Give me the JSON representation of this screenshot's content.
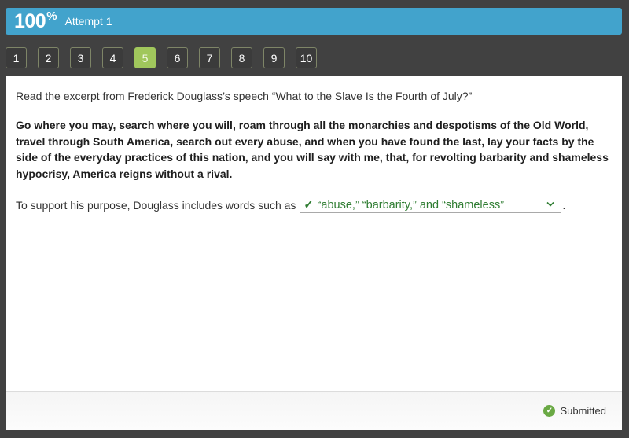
{
  "header": {
    "score": "100",
    "score_suffix": "%",
    "attempt_label": "Attempt 1",
    "accent_color": "#42a3cc"
  },
  "question_nav": {
    "items": [
      {
        "label": "1",
        "active": false
      },
      {
        "label": "2",
        "active": false
      },
      {
        "label": "3",
        "active": false
      },
      {
        "label": "4",
        "active": false
      },
      {
        "label": "5",
        "active": true
      },
      {
        "label": "6",
        "active": false
      },
      {
        "label": "7",
        "active": false
      },
      {
        "label": "8",
        "active": false
      },
      {
        "label": "9",
        "active": false
      },
      {
        "label": "10",
        "active": false
      }
    ],
    "active_color": "#a0c75c"
  },
  "question": {
    "intro": "Read the excerpt from Frederick Douglass’s speech “What to the Slave Is the Fourth of July?”",
    "excerpt": "Go where you may, search where you will, roam through all the monarchies and despotisms of the Old World, travel through South America, search out every abuse, and when you have found the last, lay your facts by the side of the everyday practices of this nation, and you will say with me, that, for revolting barbarity and shameless hypocrisy, America reigns without a rival.",
    "prompt_before": "To support his purpose, Douglass includes words such as",
    "prompt_after": ".",
    "dropdown": {
      "selected_value": "“abuse,” “barbarity,” and “shameless”",
      "status_icon": "check-icon",
      "check_glyph": "✓",
      "chevron_glyph": "⌄",
      "correct_color": "#2f7d32"
    }
  },
  "footer": {
    "status_label": "Submitted",
    "status_icon": "check-circle-icon",
    "status_glyph": "✓",
    "status_color": "#6aa944"
  }
}
